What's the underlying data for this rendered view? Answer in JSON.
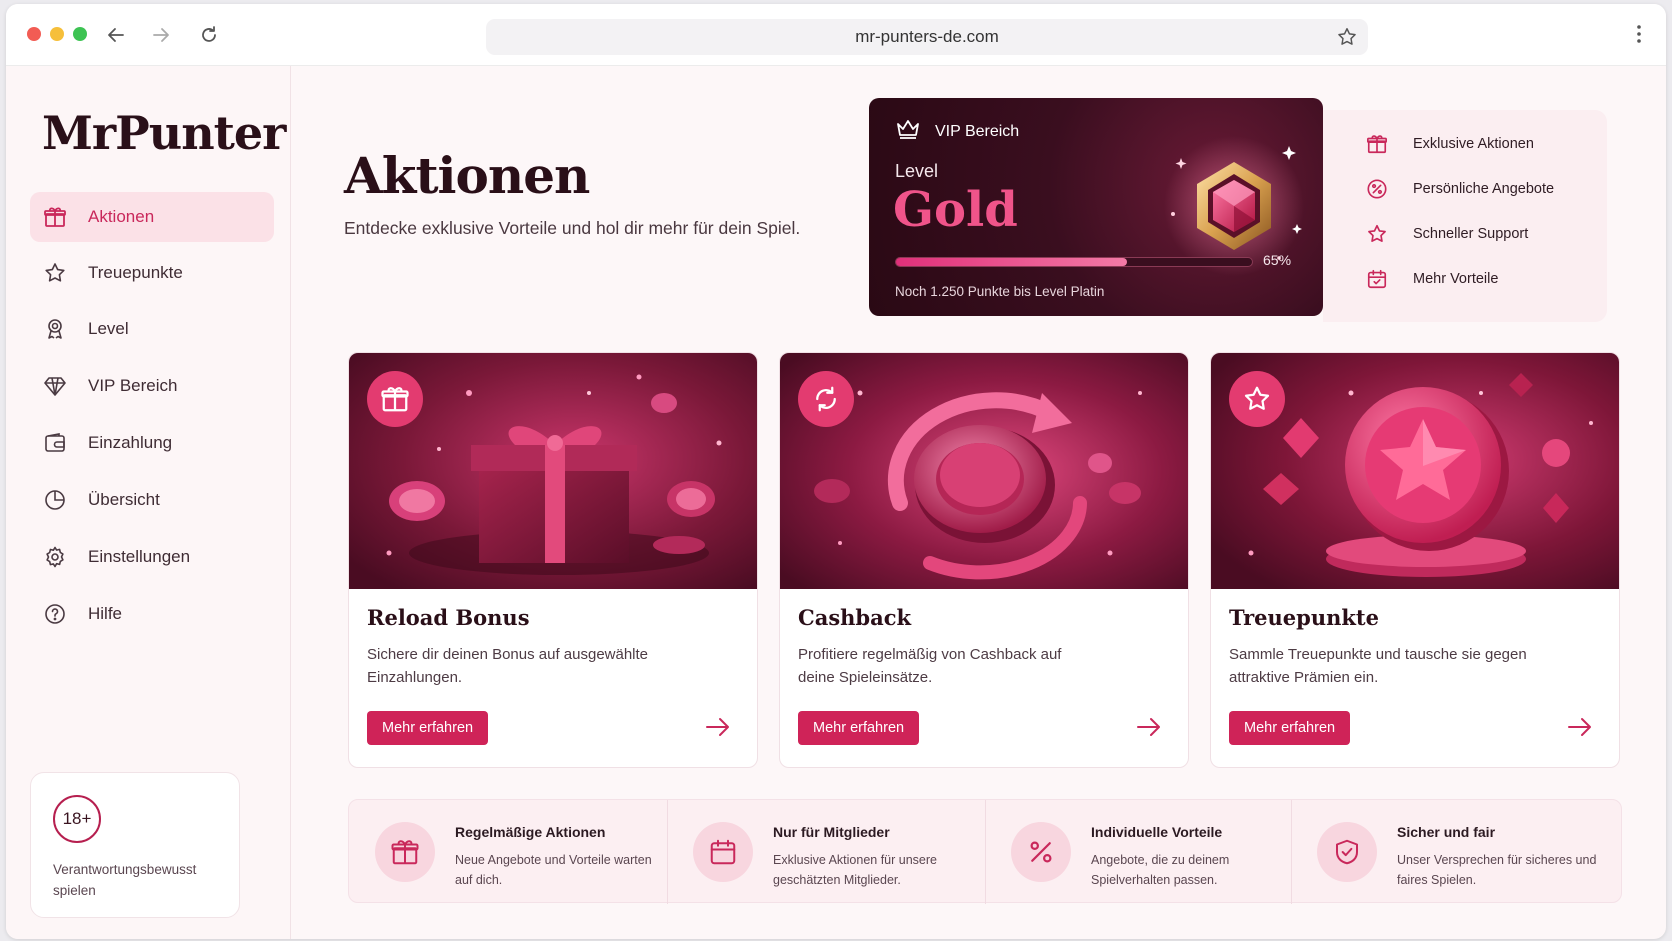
{
  "browser": {
    "url": "mr-punters-de.com"
  },
  "sidebar": {
    "logo": "MrPunter",
    "items": [
      {
        "label": "Aktionen",
        "icon": "gift-icon",
        "active": true
      },
      {
        "label": "Treuepunkte",
        "icon": "star-icon"
      },
      {
        "label": "Level",
        "icon": "award-icon"
      },
      {
        "label": "VIP Bereich",
        "icon": "diamond-icon"
      },
      {
        "label": "Einzahlung",
        "icon": "wallet-icon"
      },
      {
        "label": "Übersicht",
        "icon": "pie-chart-icon"
      },
      {
        "label": "Einstellungen",
        "icon": "gear-icon"
      },
      {
        "label": "Hilfe",
        "icon": "help-icon"
      }
    ],
    "responsible": {
      "badge": "18+",
      "text": "Verantwortungsbewusst spielen"
    }
  },
  "main": {
    "title": "Aktionen",
    "subtitle": "Entdecke exklusive Vorteile und hol dir mehr für dein Spiel."
  },
  "vip": {
    "header": "VIP Bereich",
    "level_label": "Level",
    "level": "Gold",
    "progress": 0.65,
    "progress_text": "65%",
    "note": "Noch 1.250 Punkte bis Level Platin",
    "perks": [
      {
        "label": "Exklusive Aktionen",
        "icon": "gift-icon"
      },
      {
        "label": "Persönliche Angebote",
        "icon": "percent-icon"
      },
      {
        "label": "Schneller Support",
        "icon": "star-icon"
      },
      {
        "label": "Mehr Vorteile",
        "icon": "calendar-check-icon"
      }
    ]
  },
  "cards": [
    {
      "title": "Reload Bonus",
      "desc": "Sichere dir deinen Bonus auf ausgewählte Einzahlungen.",
      "button": "Mehr erfahren",
      "icon": "gift-icon"
    },
    {
      "title": "Cashback",
      "desc": "Profitiere regelmäßig von Cashback auf deine Spieleinsätze.",
      "button": "Mehr erfahren",
      "icon": "refresh-icon"
    },
    {
      "title": "Treuepunkte",
      "desc": "Sammle Treuepunkte und tausche sie gegen attraktive Prämien ein.",
      "button": "Mehr erfahren",
      "icon": "star-icon"
    }
  ],
  "features": [
    {
      "title": "Regelmäßige Aktionen",
      "desc": "Neue Angebote und Vorteile warten auf dich.",
      "icon": "gift-icon"
    },
    {
      "title": "Nur für Mitglieder",
      "desc": "Exklusive Aktionen für unsere geschätzten Mitglieder.",
      "icon": "calendar-icon"
    },
    {
      "title": "Individuelle Vorteile",
      "desc": "Angebote, die zu deinem Spielverhalten passen.",
      "icon": "percent-icon"
    },
    {
      "title": "Sicher und fair",
      "desc": "Unser Versprechen für sicheres und faires Spielen.",
      "icon": "shield-check-icon"
    }
  ],
  "colors": {
    "accent": "#cf2358",
    "brand_dark": "#2a0f18",
    "vip_gold_text": "#f0548a"
  }
}
